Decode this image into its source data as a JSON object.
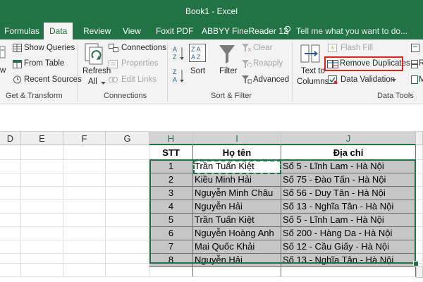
{
  "window": {
    "title": "Book1 - Excel"
  },
  "tabs": [
    {
      "label": "Formulas",
      "active": false
    },
    {
      "label": "Data",
      "active": true
    },
    {
      "label": "Review",
      "active": false
    },
    {
      "label": "View",
      "active": false
    },
    {
      "label": "Foxit PDF",
      "active": false
    },
    {
      "label": "ABBYY FineReader 12",
      "active": false
    }
  ],
  "tellme": "Tell me what you want to do...",
  "ribbon": {
    "get_transform": {
      "group_label": "Get & Transform",
      "show_queries": "Show Queries",
      "from_table": "From Table",
      "recent_sources": "Recent Sources",
      "cut_left": "w"
    },
    "connections": {
      "group_label": "Connections",
      "refresh_all_line1": "Refresh",
      "refresh_all_line2": "All",
      "connections": "Connections",
      "properties": "Properties",
      "edit_links": "Edit Links"
    },
    "sort_filter": {
      "group_label": "Sort & Filter",
      "sort": "Sort",
      "filter": "Filter",
      "clear": "Clear",
      "reapply": "Reapply",
      "advanced": "Advanced"
    },
    "data_tools": {
      "group_label": "Data Tools",
      "text_to_columns_line1": "Text to",
      "text_to_columns_line2": "Columns",
      "flash_fill": "Flash Fill",
      "remove_duplicates": "Remove Duplicates",
      "data_validation": "Data Validation",
      "cut_right_1": "R",
      "cut_right_2": "M"
    }
  },
  "sheet": {
    "columns": [
      "D",
      "E",
      "F",
      "G",
      "H",
      "I",
      "J"
    ],
    "selected_columns": [
      "H",
      "I",
      "J"
    ],
    "table": {
      "headers": [
        "STT",
        "Họ tên",
        "Địa chỉ"
      ],
      "rows": [
        [
          "1",
          "Trần Tuấn Kiệt",
          "Số 5 - Lĩnh Lam - Hà Nội"
        ],
        [
          "2",
          "Kiều Minh Hải",
          "Số 75 - Đào Tấn - Hà Nội"
        ],
        [
          "3",
          "Nguyễn Minh Châu",
          "Số 56 - Duy Tân - Hà Nội"
        ],
        [
          "4",
          "Nguyễn Hải",
          "Số 13 - Nghĩa Tân - Hà Nội"
        ],
        [
          "5",
          "Trần Tuấn Kiệt",
          "Số 5 - Lĩnh Lam - Hà Nội"
        ],
        [
          "6",
          "Nguyễn Hoàng Anh",
          "Số 200 - Hàng Da - Hà Nội"
        ],
        [
          "7",
          "Mai Quốc Khải",
          "Số 12 - Cầu Giấy - Hà Nội"
        ],
        [
          "8",
          "Nguyễn Hải",
          "Số 13 - Nghĩa Tân - Hà Nội"
        ]
      ]
    }
  },
  "colors": {
    "excel_green": "#217346",
    "highlight_red": "#d9251d",
    "selection_fill": "#c6c6c6"
  }
}
